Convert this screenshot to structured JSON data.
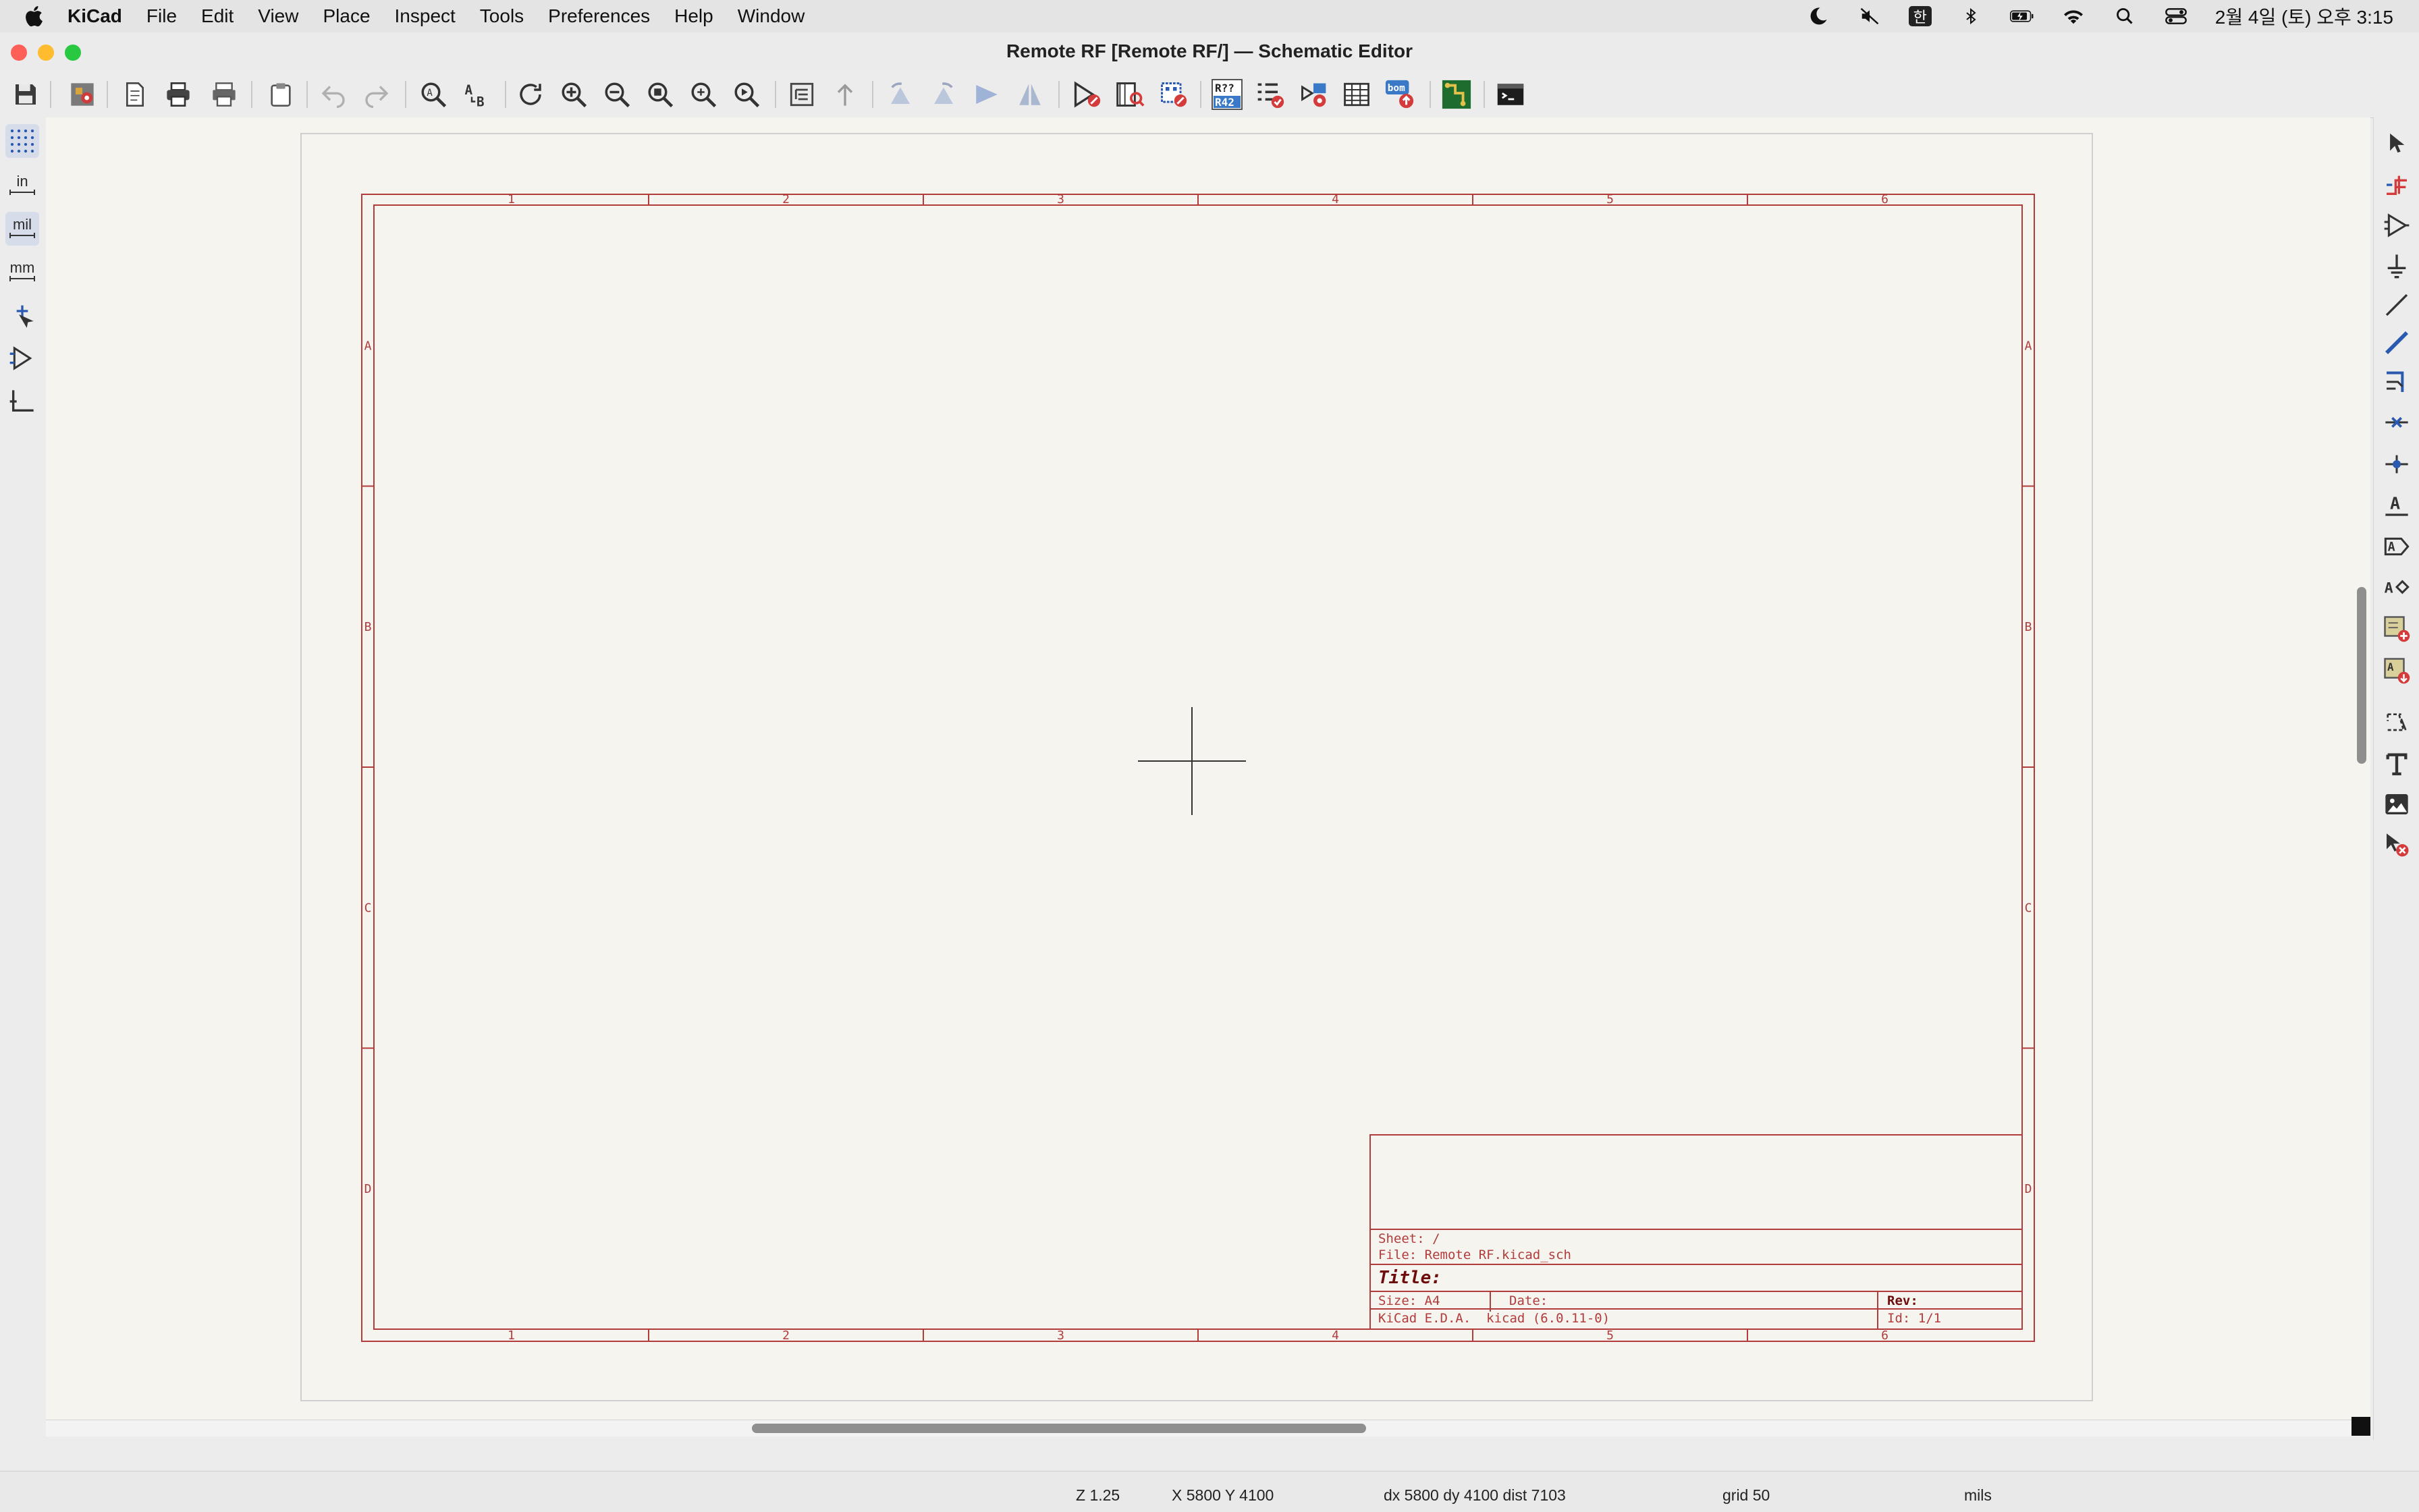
{
  "menubar": {
    "app_name": "KiCad",
    "items": [
      "File",
      "Edit",
      "View",
      "Place",
      "Inspect",
      "Tools",
      "Preferences",
      "Help",
      "Window"
    ],
    "input_source": "한",
    "clock": "2월 4일 (토) 오후 3:15"
  },
  "window": {
    "title": "Remote RF [Remote RF/] — Schematic Editor"
  },
  "toolbar": {
    "icons": [
      "save-icon",
      "schematic-setup-icon",
      "page-settings-icon",
      "print-icon",
      "plot-icon",
      "paste-icon",
      "undo-icon",
      "redo-icon",
      "find-icon",
      "find-replace-icon",
      "refresh-icon",
      "zoom-in-icon",
      "zoom-out-icon",
      "zoom-fit-icon",
      "zoom-objects-icon",
      "zoom-selection-icon",
      "hierarchy-navigator-icon",
      "leave-sheet-icon",
      "rotate-ccw-icon",
      "rotate-cw-icon",
      "mirror-vertical-icon",
      "mirror-horizontal-icon",
      "symbol-editor-icon",
      "symbol-browser-icon",
      "footprint-editor-icon",
      "annotate-icon",
      "erc-icon",
      "assign-footprints-icon",
      "edit-fields-table-icon",
      "bom-icon",
      "pcb-editor-icon",
      "scripting-console-icon"
    ],
    "annotate_label": "R??\nR42",
    "bom_label": "bom"
  },
  "left_toolbar": {
    "units": {
      "in": "in",
      "mil": "mil",
      "mm": "mm"
    },
    "active_unit": "mil"
  },
  "right_toolbar": {
    "icons": [
      "select-icon",
      "highlight-net-icon",
      "add-symbol-icon",
      "add-power-icon",
      "add-wire-icon",
      "add-bus-icon",
      "add-bus-entry-icon",
      "no-connect-icon",
      "junction-icon",
      "add-label-icon",
      "add-global-label-icon",
      "add-hierarchical-label-icon",
      "add-sheet-icon",
      "import-sheet-pin-icon",
      "add-graphic-line-icon",
      "add-text-icon",
      "add-image-icon",
      "delete-icon"
    ]
  },
  "drawing_sheet": {
    "columns": [
      "1",
      "2",
      "3",
      "4",
      "5",
      "6"
    ],
    "rows": [
      "A",
      "B",
      "C",
      "D"
    ],
    "title_block": {
      "sheet": "Sheet: /",
      "file": "File: Remote RF.kicad_sch",
      "title": "Title:",
      "size": "Size: A4",
      "date": "Date:",
      "rev": "Rev:",
      "generator": "KiCad E.D.A.  kicad (6.0.11-0)",
      "id": "Id: 1/1"
    }
  },
  "statusbar": {
    "zoom": "Z 1.25",
    "coords": "X 5800  Y 4100",
    "delta": "dx 5800  dy 4100  dist 7103",
    "grid": "grid 50",
    "units": "mils"
  },
  "colors": {
    "sheet_border": "#b23b3b",
    "title_dark": "#6e0b0b",
    "canvas": "#f5f4ef"
  }
}
